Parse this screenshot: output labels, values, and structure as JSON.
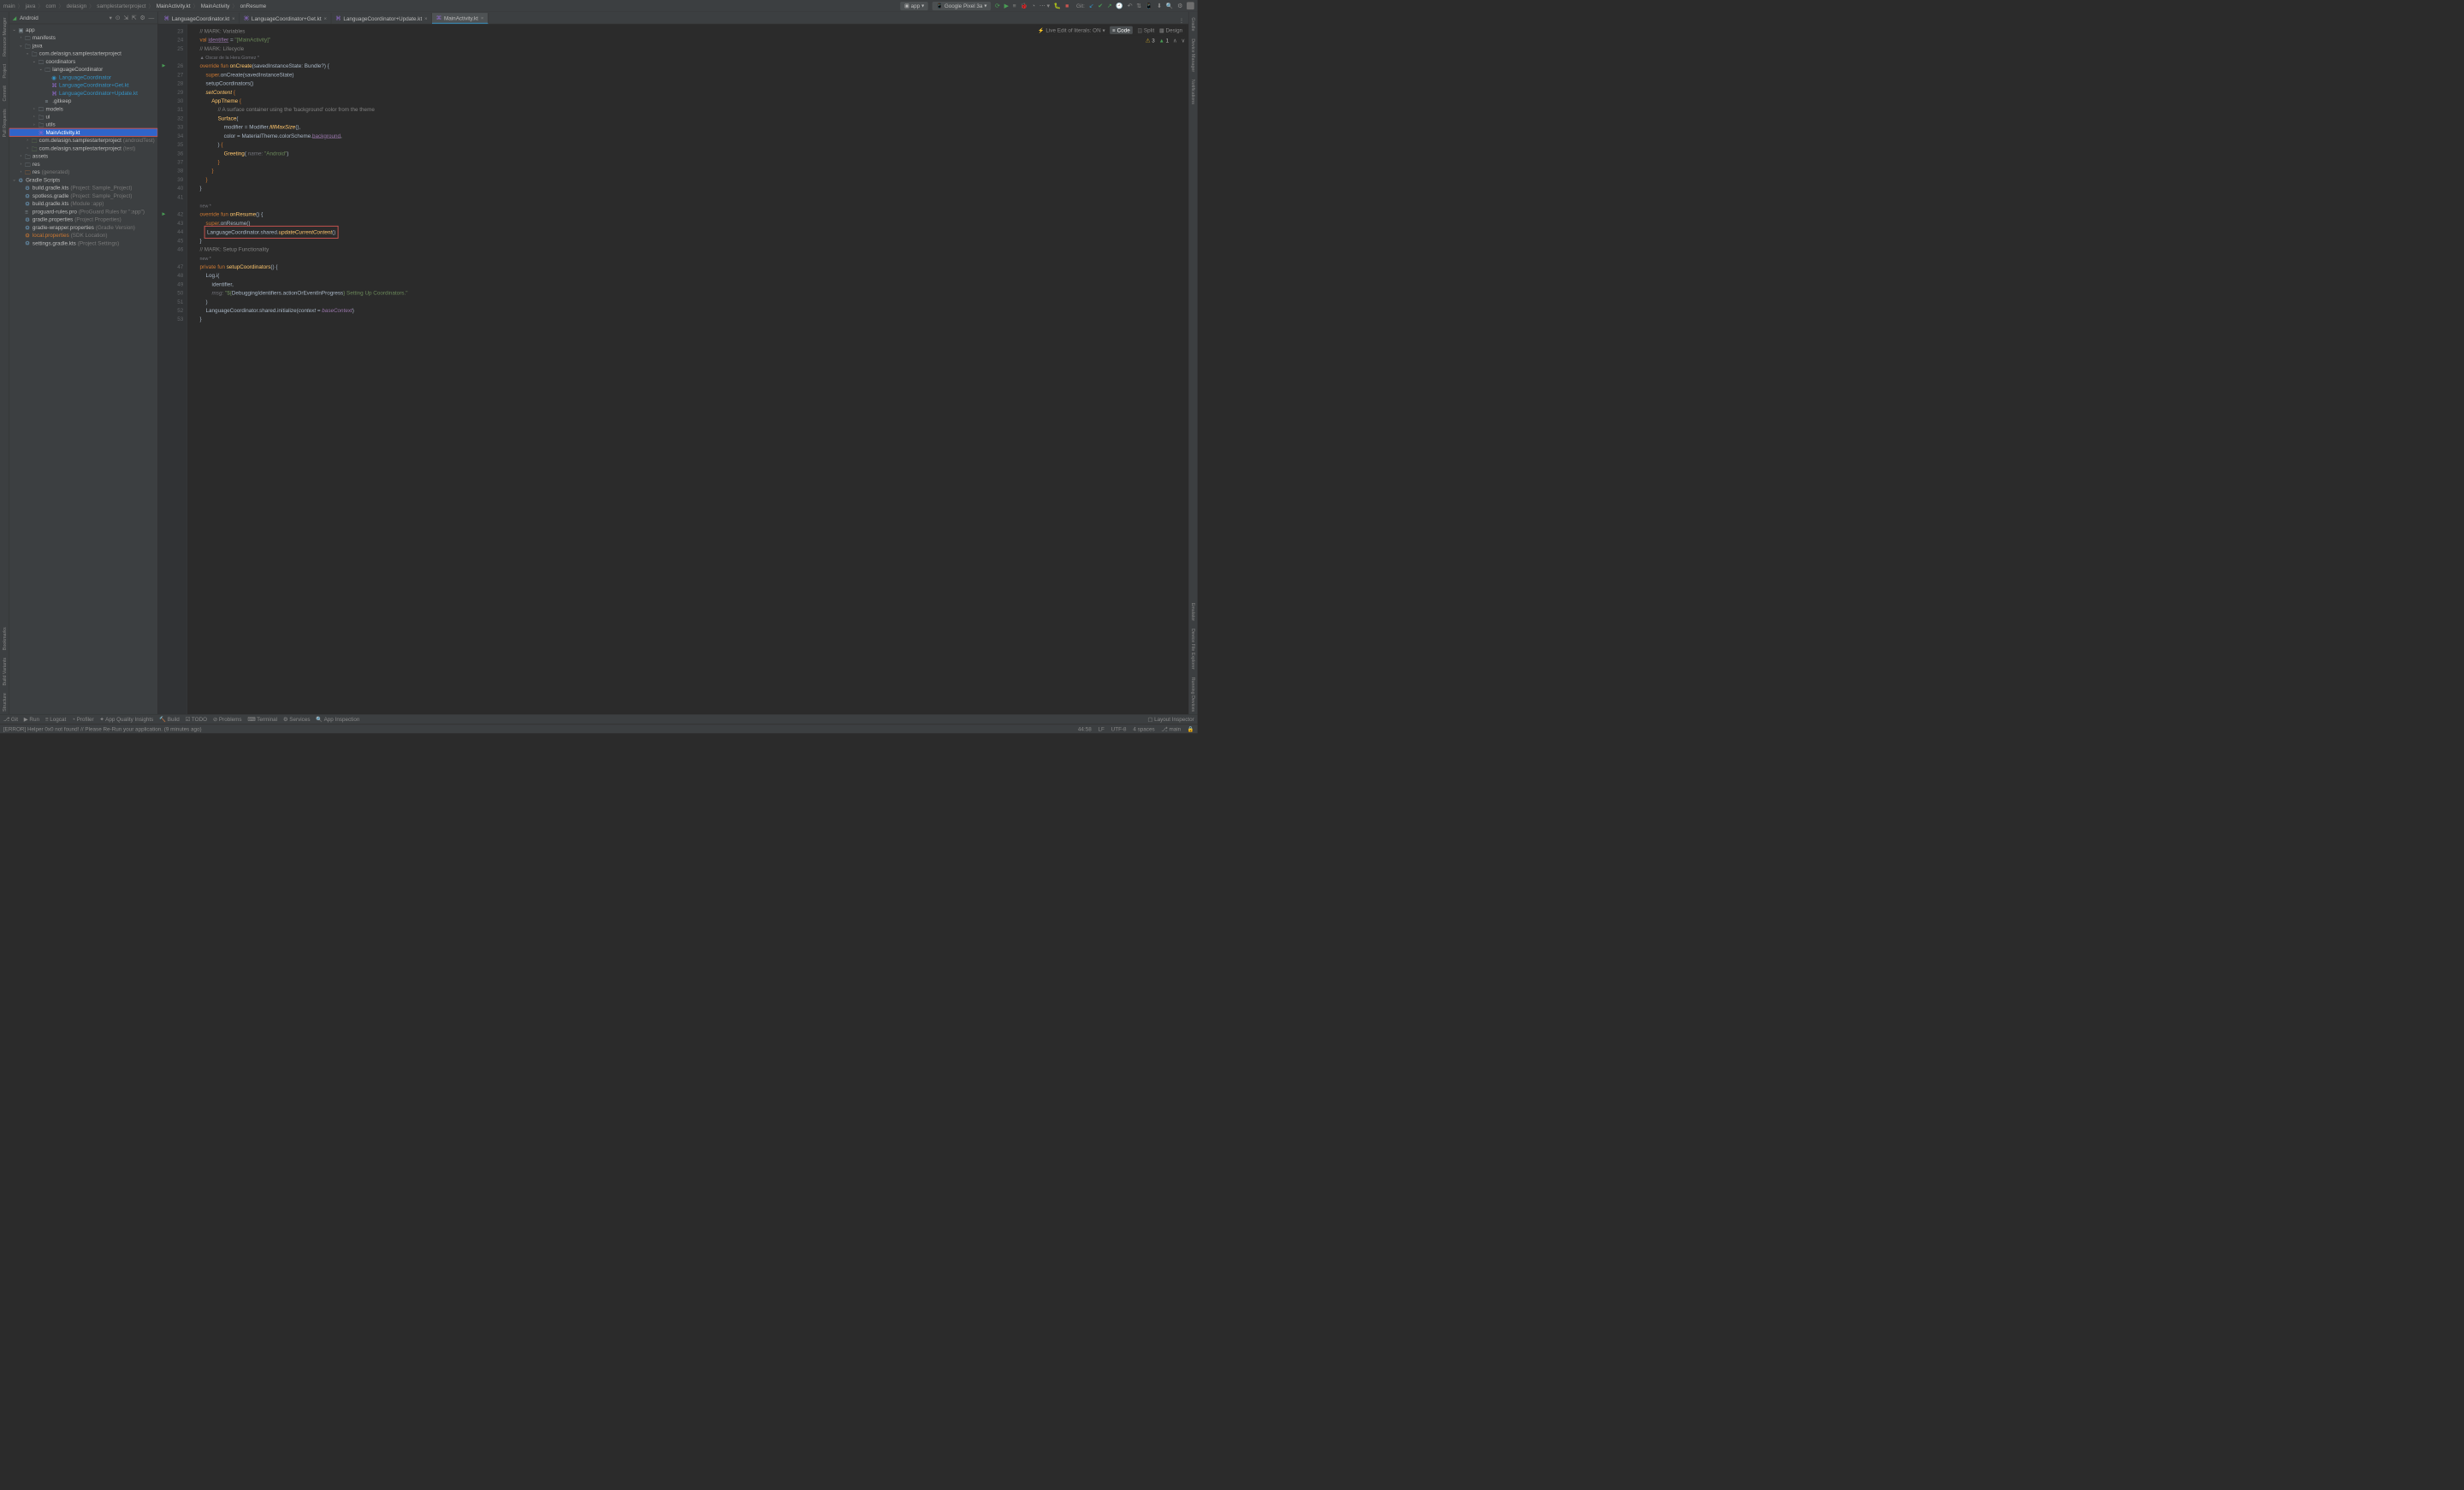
{
  "breadcrumb": [
    "main",
    "java",
    "com",
    "delasign",
    "samplestarterproject",
    "MainActivity.kt",
    "MainActivity",
    "onResume"
  ],
  "run_config": "app",
  "device": "Google Pixel 3a",
  "git_label": "Git:",
  "left_rail": {
    "top": [
      "Resource Manager",
      "Project",
      "Commit",
      "Pull Requests"
    ],
    "bottom": [
      "Bookmarks",
      "Build Variants",
      "Structure"
    ]
  },
  "right_rail": {
    "top": [
      "Gradle",
      "Device Manager",
      "Notifications"
    ],
    "bottom": [
      "Emulator",
      "Device File Explorer",
      "Running Devices"
    ]
  },
  "panel_title": "Android",
  "tree": {
    "app": "app",
    "manifests": "manifests",
    "java": "java",
    "pkg": "com.delasign.samplestarterproject",
    "coordinators": "coordinators",
    "langCoord": "languageCoordinator",
    "lc1": "LanguageCoordinator",
    "lc2": "LanguageCoordinator+Get.kt",
    "lc3": "LanguageCoordinator+Update.kt",
    "gitkeep": ".gitkeep",
    "models": "models",
    "ui": "ui",
    "utils": "utils",
    "main": "MainActivity.kt",
    "pkg_at": "com.delasign.samplestarterproject",
    "pkg_at_suffix": " (androidTest)",
    "pkg_t": "com.delasign.samplestarterproject",
    "pkg_t_suffix": " (test)",
    "assets": "assets",
    "res1": "res",
    "res2": "res",
    "res2_suffix": " (generated)",
    "gradle": "Gradle Scripts",
    "bg1": "build.gradle.kts",
    "bg1s": " (Project: Sample_Project)",
    "sg": "spotless.gradle",
    "sgs": " (Project: Sample_Project)",
    "bg2": "build.gradle.kts",
    "bg2s": " (Module :app)",
    "pg": "proguard-rules.pro",
    "pgs": " (ProGuard Rules for \":app\")",
    "gp": "gradle.properties",
    "gps": " (Project Properties)",
    "gw": "gradle-wrapper.properties",
    "gws": " (Gradle Version)",
    "lp": "local.properties",
    "lps": " (SDK Location)",
    "st": "settings.gradle.kts",
    "sts": " (Project Settings)"
  },
  "tabs": [
    {
      "label": "LanguageCoordinator.kt"
    },
    {
      "label": "LanguageCoordinator+Get.kt"
    },
    {
      "label": "LanguageCoordinator+Update.kt"
    },
    {
      "label": "MainActivity.kt",
      "active": true
    }
  ],
  "view_toolbar": {
    "liveedit": "Live Edit of literals: ON",
    "code": "Code",
    "split": "Split",
    "design": "Design"
  },
  "warnings": {
    "w": "3",
    "g": "1"
  },
  "code_lines": [
    {
      "n": 23,
      "html": "    <span class='comment'>// MARK: Variables</span>"
    },
    {
      "n": 24,
      "html": "    <span class='kw'>val</span> <span class='prop' style='text-decoration:underline'>identifier</span> = <span class='str'>\"[MainActivity]\"</span>"
    },
    {
      "n": 25,
      "html": "    <span class='comment'>// MARK: Lifecycle</span>"
    },
    {
      "n": "",
      "html": "    <span class='author'>▲ Oscar de la Hera Gomez *</span>"
    },
    {
      "n": 26,
      "html": "    <span class='kw'>override fun</span> <span class='fn'>onCreate</span>(savedInstanceState: Bundle?) {",
      "run": true
    },
    {
      "n": 27,
      "html": "        <span class='kw'>super</span>.onCreate(savedInstanceState)"
    },
    {
      "n": 28,
      "html": "        setupCoordinators()"
    },
    {
      "n": 29,
      "html": "        <span class='fn' style='font-style:italic'>setContent</span> <span class='kw'>{</span>"
    },
    {
      "n": 30,
      "html": "            <span class='fn'>AppTheme</span> <span class='kw'>{</span>"
    },
    {
      "n": 31,
      "html": "                <span class='comment'>// A surface container using the 'background' color from the theme</span>"
    },
    {
      "n": 32,
      "html": "                <span class='fn'>Surface</span>("
    },
    {
      "n": 33,
      "html": "                    modifier = Modifier.<span class='fn' style='font-style:italic'>fillMaxSize</span>(),"
    },
    {
      "n": 34,
      "html": "                    color = MaterialTheme.colorScheme.<span class='prop' style='text-decoration:underline'>background</span>,"
    },
    {
      "n": 35,
      "html": "                ) <span class='kw'>{</span>"
    },
    {
      "n": 36,
      "html": "                    <span class='fn'>Greeting</span>( <span class='param'>name:</span> <span class='str'>\"Android\"</span>)"
    },
    {
      "n": 37,
      "html": "                <span class='kw'>}</span>"
    },
    {
      "n": 38,
      "html": "            <span class='kw'>}</span>"
    },
    {
      "n": 39,
      "html": "        <span class='kw'>}</span>"
    },
    {
      "n": 40,
      "html": "    }"
    },
    {
      "n": 41,
      "html": ""
    },
    {
      "n": "",
      "html": "    <span class='author'>new *</span>"
    },
    {
      "n": 42,
      "html": "    <span class='kw'>override fun</span> <span class='fn'>onResume</span>() {",
      "run": true
    },
    {
      "n": 43,
      "html": "        <span class='kw'>super</span>.onResume()"
    },
    {
      "n": 44,
      "html": "        <span class='hl-box'>LanguageCoordinator.shared.<span class='fn' style='font-style:italic'>updateCurrentContent</span>()</span>"
    },
    {
      "n": 45,
      "html": "    }"
    },
    {
      "n": 46,
      "html": "    <span class='comment'>// MARK: Setup Functionality</span>"
    },
    {
      "n": "",
      "html": "    <span class='author'>new *</span>"
    },
    {
      "n": 47,
      "html": "    <span class='kw'>private fun</span> <span class='fn'>setupCoordinators</span>() {"
    },
    {
      "n": 48,
      "html": "        Log.i("
    },
    {
      "n": 49,
      "html": "            identifier,"
    },
    {
      "n": 50,
      "html": "            <span class='param'>msg:</span> <span class='str'>\"${</span>DebuggingIdentifiers.actionOrEventInProgress<span class='str'>}</span> <span class='str'>Setting Up Coordinators.\"</span>"
    },
    {
      "n": 51,
      "html": "        )"
    },
    {
      "n": 52,
      "html": "        LanguageCoordinator.shared.initialize(<span style='font-style:italic'>context</span> = <span class='prop' style='font-style:italic'>baseContext</span>)"
    },
    {
      "n": 53,
      "html": "    }"
    }
  ],
  "bottom_tabs": [
    "Git",
    "Run",
    "Logcat",
    "Profiler",
    "App Quality Insights",
    "Build",
    "TODO",
    "Problems",
    "Terminal",
    "Services",
    "App Inspection"
  ],
  "bottom_right": "Layout Inspector",
  "status_msg": "[ERROR] Helper 0x0 not found! // Please Re-Run your application. (9 minutes ago)",
  "status": {
    "pos": "44:58",
    "lf": "LF",
    "enc": "UTF-8",
    "indent": "4 spaces",
    "branch": "main"
  }
}
